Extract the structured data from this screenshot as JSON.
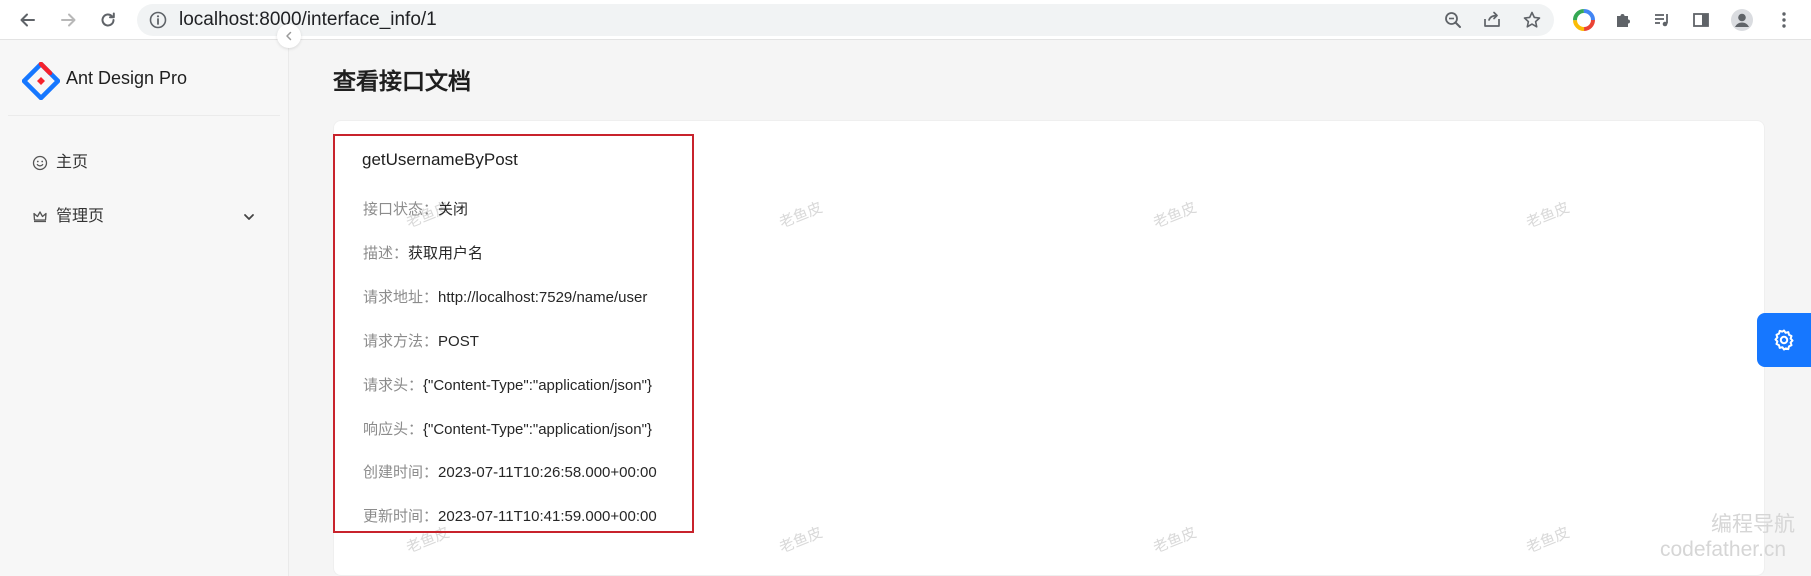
{
  "browser": {
    "url": "localhost:8000/interface_info/1"
  },
  "sidebar": {
    "app_title": "Ant Design Pro",
    "items": [
      {
        "label": "主页"
      },
      {
        "label": "管理页"
      }
    ]
  },
  "page": {
    "title": "查看接口文档"
  },
  "api": {
    "name": "getUsernameByPost",
    "fields": [
      {
        "key": "接口状态：",
        "value": "关闭"
      },
      {
        "key": "描述：",
        "value": "获取用户名"
      },
      {
        "key": "请求地址：",
        "value": "http://localhost:7529/name/user"
      },
      {
        "key": "请求方法：",
        "value": "POST"
      },
      {
        "key": "请求头：",
        "value": "{\"Content-Type\":\"application/json\"}"
      },
      {
        "key": "响应头：",
        "value": "{\"Content-Type\":\"application/json\"}"
      },
      {
        "key": "创建时间：",
        "value": "2023-07-11T10:26:58.000+00:00"
      },
      {
        "key": "更新时间：",
        "value": "2023-07-11T10:41:59.000+00:00"
      }
    ]
  },
  "watermark": {
    "text": "老鱼皮"
  },
  "corner_watermark": {
    "line1": "编程导航",
    "line2": "codefather.cn"
  },
  "colors": {
    "primary": "#1677ff",
    "highlight_border": "#c8232c"
  },
  "icons": {
    "back": "arrow-left-icon",
    "forward": "arrow-right-icon",
    "reload": "reload-icon",
    "site_info": "info-icon",
    "zoom": "zoom-icon",
    "share": "share-icon",
    "bookmark": "star-icon",
    "extension_color": "color-wheel-icon",
    "extensions": "puzzle-icon",
    "media": "media-queue-icon",
    "side_panel": "side-panel-icon",
    "profile": "profile-icon",
    "menu": "kebab-menu-icon",
    "home": "smile-icon",
    "admin": "crown-icon",
    "expand": "chevron-down-icon",
    "collapse": "chevron-left-icon",
    "settings": "gear-icon"
  }
}
